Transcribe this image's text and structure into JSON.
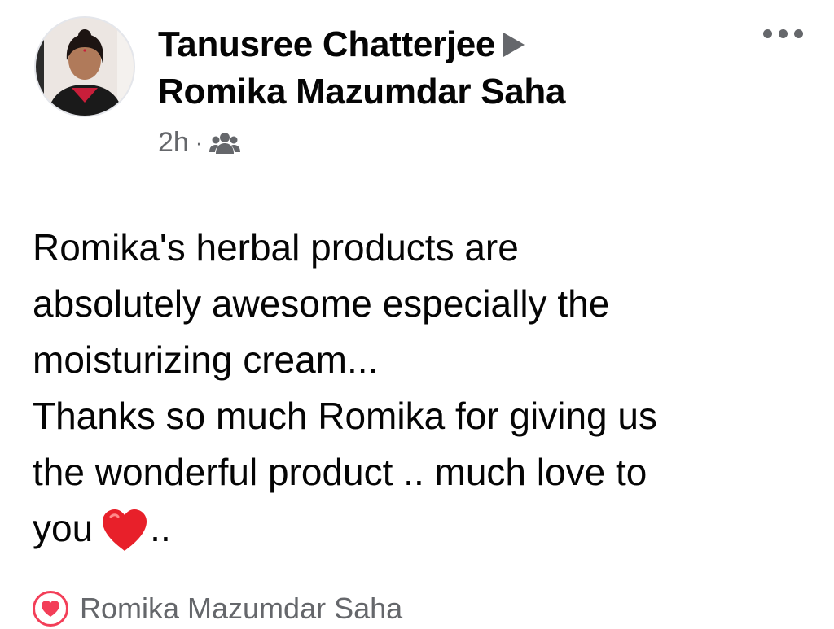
{
  "post": {
    "author": "Tanusree Chatterjee",
    "recipient": "Romika Mazumdar Saha",
    "time": "2h",
    "separator": "·",
    "audience_icon": "friends-icon",
    "more_icon": "more-options-icon",
    "text_lines": [
      "Romika's herbal products are",
      "absolutely awesome especially the",
      "moisturizing cream...",
      "Thanks so much Romika for giving us",
      "the wonderful product .. much love to",
      "you"
    ],
    "emoji": "red-heart",
    "text_tail": ".."
  },
  "footer": {
    "reaction_icon": "heart-reaction-icon",
    "reactor": "Romika Mazumdar Saha"
  },
  "colors": {
    "heart": "#e8202a",
    "secondary_text": "#65676b",
    "primary_text": "#050505"
  }
}
